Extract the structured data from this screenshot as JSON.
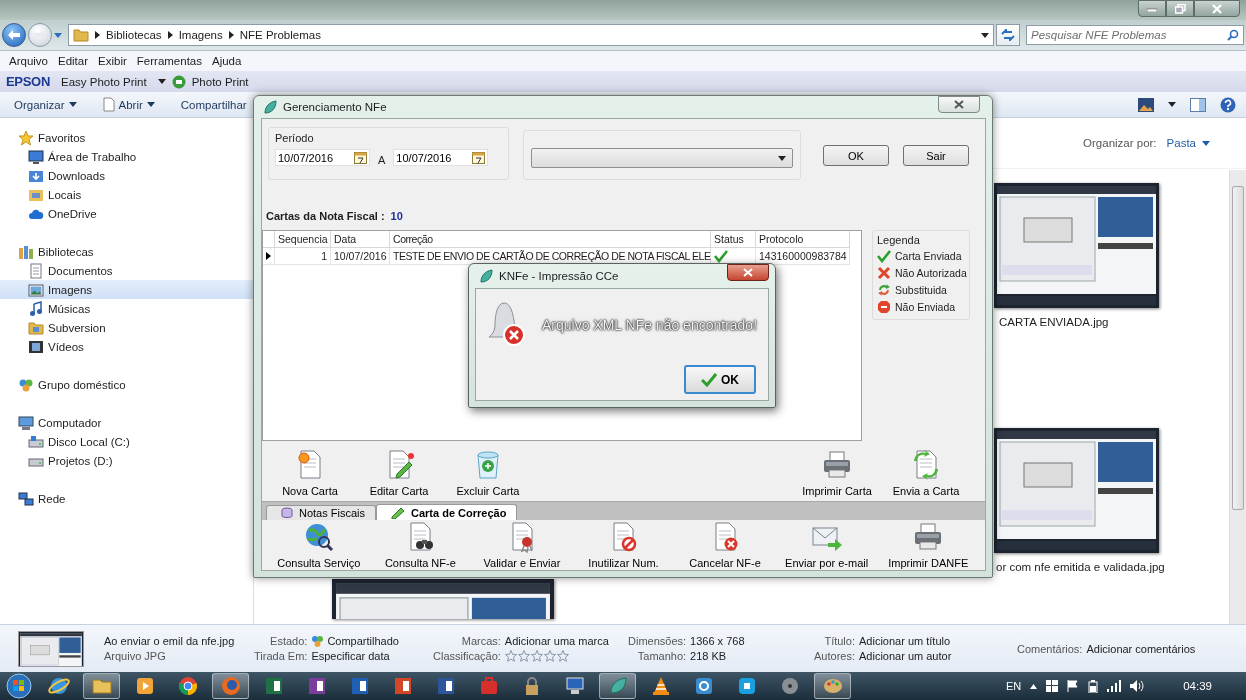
{
  "address": {
    "crumbs": [
      "Bibliotecas",
      "Imagens",
      "NFE Problemas"
    ]
  },
  "search": {
    "placeholder": "Pesquisar NFE Problemas"
  },
  "menu": [
    "Arquivo",
    "Editar",
    "Exibir",
    "Ferramentas",
    "Ajuda"
  ],
  "epson_bar": {
    "brand": "EPSON",
    "app": "Easy Photo Print",
    "photo_print": "Photo Print"
  },
  "commands": [
    {
      "label": "Organizar",
      "kind": "plain",
      "dropdown": true
    },
    {
      "label": "Abrir",
      "kind": "open",
      "dropdown": true
    },
    {
      "label": "Compartilhar",
      "kind": "plain"
    }
  ],
  "sidebar": {
    "groups": [
      {
        "label": "Favoritos",
        "kind": "star",
        "selected": false,
        "children": [
          {
            "label": "Área de Trabalho",
            "kind": "desktop",
            "selected": false
          },
          {
            "label": "Downloads",
            "kind": "downloads",
            "selected": false
          },
          {
            "label": "Locais",
            "kind": "places",
            "selected": false
          },
          {
            "label": "OneDrive",
            "kind": "cloud",
            "selected": false
          }
        ]
      },
      {
        "label": "Bibliotecas",
        "kind": "library",
        "selected": false,
        "children": [
          {
            "label": "Documentos",
            "kind": "documents",
            "selected": false
          },
          {
            "label": "Imagens",
            "kind": "pictures",
            "selected": true
          },
          {
            "label": "Músicas",
            "kind": "music",
            "selected": false
          },
          {
            "label": "Subversion",
            "kind": "folder",
            "selected": false
          },
          {
            "label": "Vídeos",
            "kind": "videos",
            "selected": false
          }
        ]
      },
      {
        "label": "Grupo doméstico",
        "kind": "homegroup",
        "selected": false
      },
      {
        "label": "Computador",
        "kind": "computer",
        "selected": false,
        "children": [
          {
            "label": "Disco Local (C:)",
            "kind": "disk",
            "selected": false
          },
          {
            "label": "Projetos (D:)",
            "kind": "drive",
            "selected": false
          }
        ]
      },
      {
        "label": "Rede",
        "kind": "network",
        "selected": false
      }
    ]
  },
  "arrange": {
    "label": "Organizar por:",
    "value": "Pasta"
  },
  "files": [
    {
      "kind": "picture",
      "name": "CARTA ENVIADA.jpg"
    },
    {
      "kind": "picture",
      "name": "or com nfe emitida e validada.jpg"
    },
    {
      "kind": "picture"
    }
  ],
  "details": {
    "file_name": "Ao enviar o emil da nfe.jpg",
    "file_type": "Arquivo JPG",
    "columns": [
      [
        {
          "label": "Estado:",
          "value": "Compartilhado",
          "kind": "shared"
        },
        {
          "label": "Tirada Em:",
          "value": "Especificar data"
        }
      ],
      [
        {
          "label": "Marcas:",
          "value": "Adicionar uma marca"
        },
        {
          "label": "Classificação:",
          "stars": 0
        }
      ],
      [
        {
          "label": "Dimensões:",
          "value": "1366 x 768"
        },
        {
          "label": "Tamanho:",
          "value": "218 KB"
        }
      ],
      [
        {
          "label": "Título:",
          "value": "Adicionar um título"
        },
        {
          "label": "Autores:",
          "value": "Adicionar um autor"
        }
      ],
      [
        {
          "label": "Comentários:",
          "value": "Adicionar comentários"
        }
      ]
    ]
  },
  "nfe_window": {
    "title": "Gerenciamento NFe",
    "period": {
      "label": "Período",
      "from": "10/07/2016",
      "connector": "A",
      "to": "10/07/2016"
    },
    "buttons": [
      "OK",
      "Sair"
    ],
    "count_label": "Cartas da Nota Fiscal :",
    "count": "10",
    "table": {
      "columns": [
        "Sequencia",
        "Data",
        "Correção",
        "Status",
        "Protocolo"
      ],
      "rows": [
        {
          "selected": true,
          "sequencia": "1",
          "data": "10/07/2016",
          "correcao": "TESTE DE ENVIO DE CARTÃO DE CORREÇÃO DE NOTA FISCAL ELE",
          "kind": "sent",
          "protocolo": "143160000983784"
        }
      ]
    },
    "legend": {
      "title": "Legenda",
      "items": [
        {
          "kind": "sent",
          "label": "Carta Enviada"
        },
        {
          "kind": "denied",
          "label": "Não Autorizada"
        },
        {
          "kind": "replaced",
          "label": "Substituida"
        },
        {
          "kind": "stop",
          "label": "Não Enviada"
        }
      ]
    },
    "actions": [
      {
        "kind": "new",
        "label": "Nova Carta"
      },
      {
        "kind": "edit",
        "label": "Editar Carta"
      },
      {
        "kind": "delete",
        "label": "Excluir Carta"
      }
    ],
    "right_actions": [
      {
        "kind": "print",
        "label": "Imprimir Carta"
      },
      {
        "kind": "send",
        "label": "Envia a Carta"
      }
    ],
    "tabs": [
      {
        "kind": "notes",
        "label": "Notas Fiscais",
        "selected": false
      },
      {
        "kind": "letter",
        "label": "Carta de Correção",
        "selected": true
      }
    ],
    "tools": [
      {
        "kind": "globe",
        "label": "Consulta Serviço"
      },
      {
        "kind": "binoculars",
        "label": "Consulta NF-e"
      },
      {
        "kind": "seal",
        "label": "Validar e Enviar"
      },
      {
        "kind": "nosign",
        "label": "Inutilizar Num."
      },
      {
        "kind": "cancel",
        "label": "Cancelar NF-e"
      },
      {
        "kind": "mail",
        "label": "Enviar por e-mail"
      },
      {
        "kind": "print",
        "label": "Imprimir DANFE"
      }
    ]
  },
  "message_box": {
    "title": "KNFe - Impressão CCe",
    "message": "Arquivo XML NFe não encontrado!",
    "button": "OK"
  },
  "taskbar": {
    "apps": [
      {
        "kind": "ie",
        "open": false
      },
      {
        "kind": "explorer",
        "open": true
      },
      {
        "kind": "media",
        "open": false
      },
      {
        "kind": "chrome",
        "open": false
      },
      {
        "kind": "firefox",
        "open": true
      },
      {
        "kind": "sheet",
        "open": false
      },
      {
        "kind": "notebook",
        "open": false
      },
      {
        "kind": "mail",
        "open": false
      },
      {
        "kind": "slides",
        "open": false
      },
      {
        "kind": "doc",
        "open": false
      },
      {
        "kind": "toolbox",
        "open": false
      },
      {
        "kind": "lock",
        "open": false
      },
      {
        "kind": "netapp",
        "open": false
      },
      {
        "kind": "knfe",
        "open": true
      },
      {
        "kind": "cone",
        "open": false
      },
      {
        "kind": "capp",
        "open": false
      },
      {
        "kind": "chat",
        "open": false
      },
      {
        "kind": "disc",
        "open": false
      },
      {
        "kind": "paint",
        "open": true
      }
    ],
    "language": "EN",
    "clock": "04:39"
  }
}
